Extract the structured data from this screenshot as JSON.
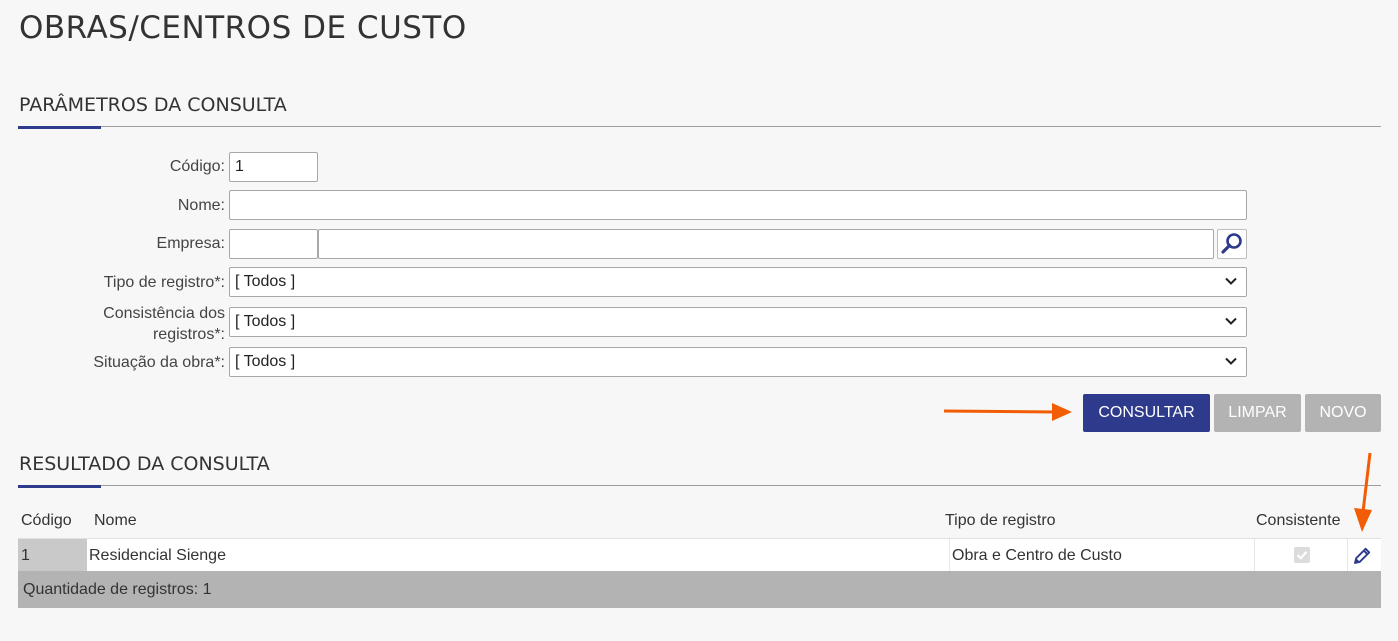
{
  "page": {
    "title": "OBRAS/CENTROS DE CUSTO"
  },
  "params": {
    "section_title": "PARÂMETROS DA CONSULTA",
    "codigo_label": "Código:",
    "codigo_value": "1",
    "nome_label": "Nome:",
    "nome_value": "",
    "empresa_label": "Empresa:",
    "empresa_code_value": "",
    "empresa_name_value": "",
    "tipo_label": "Tipo de registro*:",
    "tipo_value": "[ Todos ]",
    "consistencia_label_1": "Consistência dos",
    "consistencia_label_2": "registros*:",
    "consistencia_value": "[ Todos ]",
    "situacao_label": "Situação da obra*:",
    "situacao_value": "[ Todos ]"
  },
  "actions": {
    "consultar": "CONSULTAR",
    "limpar": "LIMPAR",
    "novo": "NOVO"
  },
  "results": {
    "section_title": "RESULTADO DA CONSULTA",
    "columns": [
      "Código",
      "Nome",
      "Tipo de registro",
      "Consistente"
    ],
    "rows": [
      {
        "codigo": "1",
        "nome": "Residencial Sienge",
        "tipo": "Obra e Centro de Custo",
        "consistente": true
      }
    ],
    "footer": "Quantidade de registros: 1"
  },
  "icons": {
    "search": "magnifier-icon",
    "edit": "pencil-icon",
    "dropdown": "chevron-down-icon",
    "annotation": "arrow-icon"
  },
  "colors": {
    "primary": "#2e3a8c",
    "disabled": "#b3b3b3",
    "annotation": "#f25c05"
  }
}
